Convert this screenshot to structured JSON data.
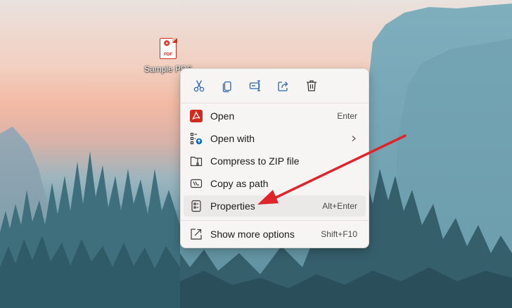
{
  "colors": {
    "accent": "#0067c0",
    "pdf_red": "#d42a1e",
    "annotation_red": "#e0242a",
    "menu_bg": "#f6f5f4"
  },
  "desktop": {
    "icon": {
      "name": "pdf-file-icon",
      "badge": "PDF",
      "label": "Sample PDF"
    }
  },
  "context_menu": {
    "toolbar": [
      {
        "icon": "cut-icon"
      },
      {
        "icon": "copy-icon"
      },
      {
        "icon": "rename-icon"
      },
      {
        "icon": "share-icon"
      },
      {
        "icon": "delete-icon"
      }
    ],
    "items": [
      {
        "icon": "acrobat-icon",
        "label": "Open",
        "shortcut": "Enter"
      },
      {
        "icon": "open-with-icon",
        "label": "Open with",
        "submenu": true
      },
      {
        "icon": "zip-folder-icon",
        "label": "Compress to ZIP file"
      },
      {
        "icon": "copy-path-icon",
        "label": "Copy as path"
      },
      {
        "icon": "properties-icon",
        "label": "Properties",
        "shortcut": "Alt+Enter",
        "highlighted": true
      }
    ],
    "more": {
      "icon": "show-more-icon",
      "label": "Show more options",
      "shortcut": "Shift+F10"
    }
  },
  "annotation": {
    "type": "arrow",
    "points_to": "Properties"
  }
}
